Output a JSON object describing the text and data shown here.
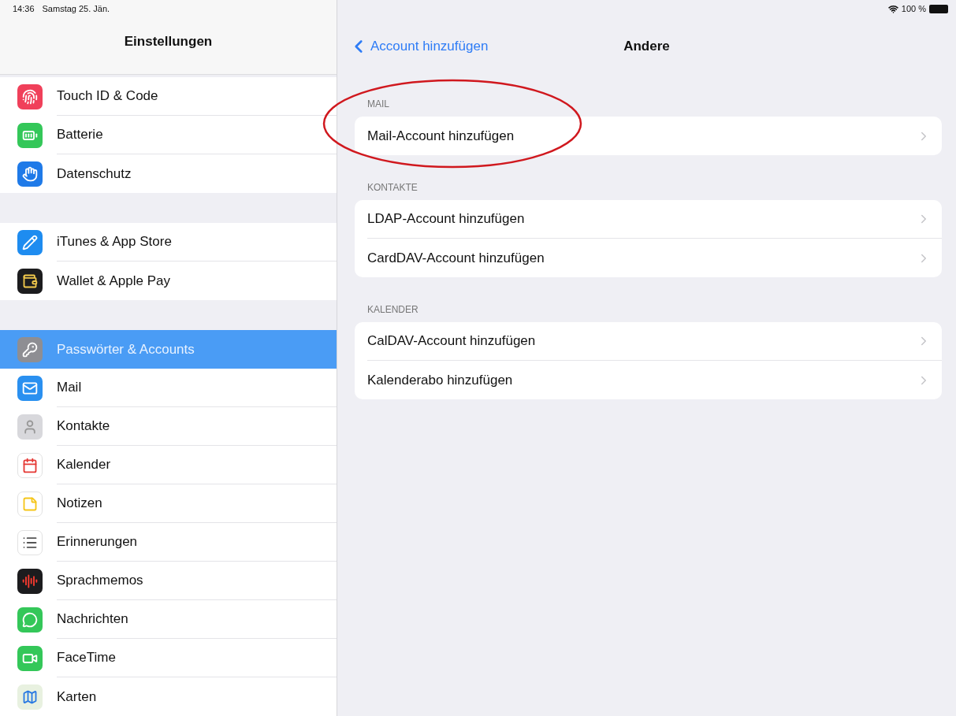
{
  "status_bar": {
    "time": "14:36",
    "date": "Samstag 25. Jän.",
    "battery": "100 %"
  },
  "sidebar": {
    "title": "Einstellungen",
    "groups": [
      {
        "items": [
          {
            "kind": "touchid",
            "label": "Touch ID & Code",
            "selected": false
          },
          {
            "kind": "battery",
            "label": "Batterie",
            "selected": false
          },
          {
            "kind": "privacy",
            "label": "Datenschutz",
            "selected": false
          }
        ]
      },
      {
        "items": [
          {
            "kind": "appstore",
            "label": "iTunes & App Store",
            "selected": false
          },
          {
            "kind": "wallet",
            "label": "Wallet & Apple Pay",
            "selected": false
          }
        ]
      },
      {
        "items": [
          {
            "kind": "passwords",
            "label": "Passwörter & Accounts",
            "selected": true
          },
          {
            "kind": "mail",
            "label": "Mail",
            "selected": false
          },
          {
            "kind": "contacts",
            "label": "Kontakte",
            "selected": false
          },
          {
            "kind": "calendar",
            "label": "Kalender",
            "selected": false
          },
          {
            "kind": "notes",
            "label": "Notizen",
            "selected": false
          },
          {
            "kind": "reminders",
            "label": "Erinnerungen",
            "selected": false
          },
          {
            "kind": "voicememos",
            "label": "Sprachmemos",
            "selected": false
          },
          {
            "kind": "messages",
            "label": "Nachrichten",
            "selected": false
          },
          {
            "kind": "facetime",
            "label": "FaceTime",
            "selected": false
          },
          {
            "kind": "maps",
            "label": "Karten",
            "selected": false
          }
        ]
      }
    ]
  },
  "detail": {
    "back": "Account hinzufügen",
    "title": "Andere",
    "sections": [
      {
        "header": "MAIL",
        "circled": true,
        "rows": [
          "Mail-Account hinzufügen"
        ]
      },
      {
        "header": "KONTAKTE",
        "circled": false,
        "rows": [
          "LDAP-Account hinzufügen",
          "CardDAV-Account hinzufügen"
        ]
      },
      {
        "header": "KALENDER",
        "circled": false,
        "rows": [
          "CalDAV-Account hinzufügen",
          "Kalenderabo hinzufügen"
        ]
      }
    ]
  }
}
